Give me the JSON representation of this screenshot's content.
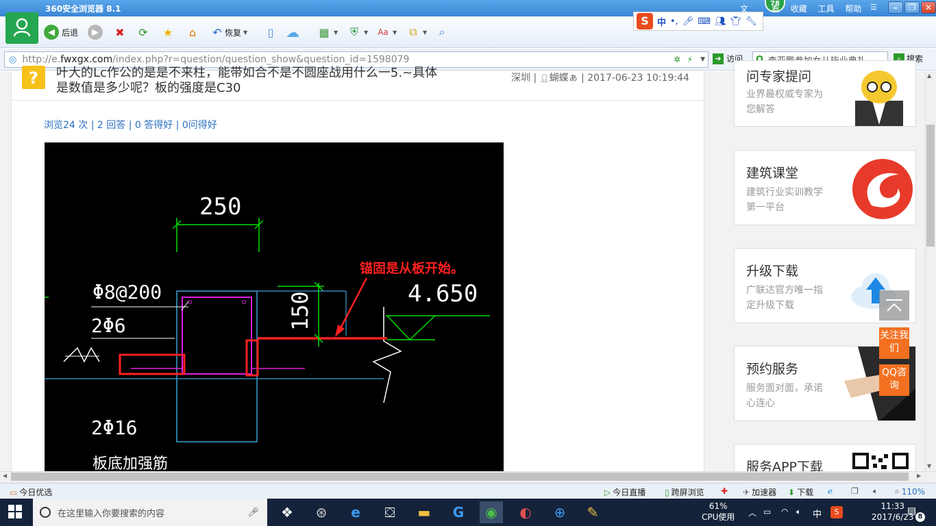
{
  "browser": {
    "title": "360安全浏览器 8.1",
    "menu": [
      "文",
      "看",
      "收藏",
      "工具",
      "帮助"
    ],
    "badge": "78",
    "toolbar": {
      "back": "后退",
      "restore": "恢复"
    },
    "ime": {
      "mode": "中"
    },
    "address": {
      "url_prefix": "http://e.",
      "url_domain": "fwxgx.com",
      "url_rest": "/index.php?r=question/question_show&question_id=1598079",
      "visit": "访问",
      "search_placeholder": "李亚鹏参加女儿毕业典礼",
      "search_btn": "搜索"
    }
  },
  "question": {
    "line1": "叶大的Lc作公的是是不来柱，能带如合不是不圆座战用什么一5.~具体",
    "line2": "是数值是多少呢？板的强度是C30",
    "meta_city": "深圳",
    "meta_user": "蝴蝶ぁ",
    "meta_time": "2017-06-23 10:19:44",
    "stats": "浏览24 次 | 2 回答 | 0 答得好 | 0问得好"
  },
  "cad": {
    "dim_top": "250",
    "label_stirrup": "Φ8@200",
    "label_top": "2Φ6",
    "annotation": "锚固是从板开始。",
    "elevation": "4.650",
    "dim_side": "150",
    "label_bottom": "2Φ16",
    "label_note": "板底加强筋"
  },
  "sidebar": {
    "cards": [
      {
        "title": "问专家提问",
        "sub": "业界最权威专家为您解答"
      },
      {
        "title": "建筑课堂",
        "sub": "建筑行业实训教学第一平台"
      },
      {
        "title": "升级下载",
        "sub": "广联达官方唯一指定升级下载"
      },
      {
        "title": "预约服务",
        "sub": "服务面对面，承诺心连心"
      },
      {
        "title": "服务APP下载",
        "sub": ""
      }
    ],
    "follow": "关注我们",
    "qq": "QQ咨询"
  },
  "statusbar": {
    "today": "今日优选",
    "live": "今日直播",
    "cross": "跨屏浏览",
    "accel": "加速器",
    "download": "下载",
    "zoom": "110%"
  },
  "taskbar": {
    "search_placeholder": "在这里输入你要搜索的内容",
    "cpu_percent": "61%",
    "cpu_label": "CPU使用",
    "ime": "中",
    "time": "11:33",
    "date": "2017/6/23",
    "notif": "8"
  },
  "colors": {
    "accent_blue": "#3a86d6",
    "brand_green": "#25a650",
    "orange": "#f37021",
    "cad_red": "#ff2020",
    "cad_green": "#00e000",
    "cad_magenta": "#e020e0"
  }
}
